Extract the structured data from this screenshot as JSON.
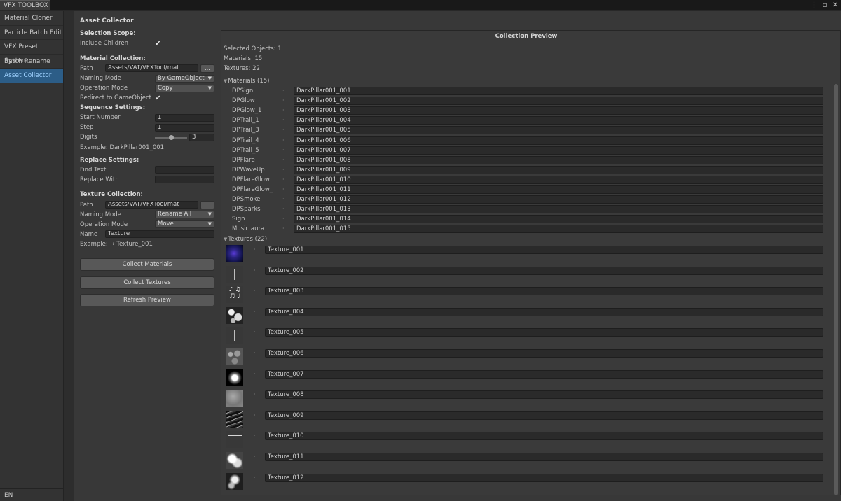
{
  "window": {
    "tab_title": "VFX TOOLBOX",
    "icons": [
      "more-vertical-icon",
      "maximize-icon",
      "close-icon"
    ]
  },
  "sidebar": {
    "items": [
      {
        "label": "Material Cloner",
        "active": false
      },
      {
        "label": "Particle Batch Edit",
        "active": false
      },
      {
        "label": "VFX Preset System",
        "active": false
      },
      {
        "label": "Batch Rename",
        "active": false
      },
      {
        "label": "Asset Collector",
        "active": true
      }
    ],
    "language": "EN"
  },
  "left": {
    "title": "Asset Collector",
    "selection_scope": {
      "heading": "Selection Scope:",
      "include_children_label": "Include Children",
      "include_children_checked": true
    },
    "material_collection": {
      "heading": "Material Collection:",
      "path_label": "Path",
      "path_value": "Assets/VAT/VFXTool/mat",
      "browse_label": "...",
      "naming_mode_label": "Naming Mode",
      "naming_mode_value": "By GameObject",
      "operation_mode_label": "Operation Mode",
      "operation_mode_value": "Copy",
      "redirect_label": "Redirect to GameObject",
      "redirect_checked": true
    },
    "sequence_settings": {
      "heading": "Sequence Settings:",
      "start_number_label": "Start Number",
      "start_number_value": "1",
      "step_label": "Step",
      "step_value": "1",
      "digits_label": "Digits",
      "digits_value": "3",
      "digits_slider_fraction": 0.5,
      "example": "Example: DarkPillar001_001"
    },
    "replace_settings": {
      "heading": "Replace Settings:",
      "find_label": "Find Text",
      "find_value": "",
      "replace_label": "Replace With",
      "replace_value": ""
    },
    "texture_collection": {
      "heading": "Texture Collection:",
      "path_label": "Path",
      "path_value": "Assets/VAT/VFXTool/mat",
      "browse_label": "...",
      "naming_mode_label": "Naming Mode",
      "naming_mode_value": "Rename All",
      "operation_mode_label": "Operation Mode",
      "operation_mode_value": "Move",
      "name_label": "Name",
      "name_value": "Texture",
      "example": "Example: → Texture_001"
    },
    "buttons": {
      "collect_materials": "Collect Materials",
      "collect_textures": "Collect Textures",
      "refresh_preview": "Refresh Preview"
    }
  },
  "preview": {
    "title": "Collection Preview",
    "selected_objects": "Selected Objects: 1",
    "materials_count": "Materials: 15",
    "textures_count": "Textures: 22",
    "materials_header": "Materials (15)",
    "materials": [
      {
        "source": "DPSign",
        "target": "DarkPillar001_001"
      },
      {
        "source": "DPGlow",
        "target": "DarkPillar001_002"
      },
      {
        "source": "DPGlow_1",
        "target": "DarkPillar001_003"
      },
      {
        "source": "DPTrail_1",
        "target": "DarkPillar001_004"
      },
      {
        "source": "DPTrail_3",
        "target": "DarkPillar001_005"
      },
      {
        "source": "DPTrail_4",
        "target": "DarkPillar001_006"
      },
      {
        "source": "DPTrail_5",
        "target": "DarkPillar001_007"
      },
      {
        "source": "DPFlare",
        "target": "DarkPillar001_008"
      },
      {
        "source": "DPWaveUp",
        "target": "DarkPillar001_009"
      },
      {
        "source": "DPFlareGlow",
        "target": "DarkPillar001_010"
      },
      {
        "source": "DPFlareGlow_",
        "target": "DarkPillar001_011"
      },
      {
        "source": "DPSmoke",
        "target": "DarkPillar001_012"
      },
      {
        "source": "DPSparks",
        "target": "DarkPillar001_013"
      },
      {
        "source": "Sign",
        "target": "DarkPillar001_014"
      },
      {
        "source": "Music aura",
        "target": "DarkPillar001_015"
      }
    ],
    "textures_header": "Textures (22)",
    "textures": [
      {
        "name": "Texture_001",
        "thumb": "blue-nebula"
      },
      {
        "name": "Texture_002",
        "thumb": "thin-line-vertical"
      },
      {
        "name": "Texture_003",
        "thumb": "music-notes"
      },
      {
        "name": "Texture_004",
        "thumb": "noise-bw"
      },
      {
        "name": "Texture_005",
        "thumb": "thin-line-vertical"
      },
      {
        "name": "Texture_006",
        "thumb": "noise-gray"
      },
      {
        "name": "Texture_007",
        "thumb": "white-dot"
      },
      {
        "name": "Texture_008",
        "thumb": "soft-gray"
      },
      {
        "name": "Texture_009",
        "thumb": "streaks"
      },
      {
        "name": "Texture_010",
        "thumb": "thin-line-horizontal"
      },
      {
        "name": "Texture_011",
        "thumb": "cloud"
      },
      {
        "name": "Texture_012",
        "thumb": "cloud-dark"
      }
    ]
  }
}
